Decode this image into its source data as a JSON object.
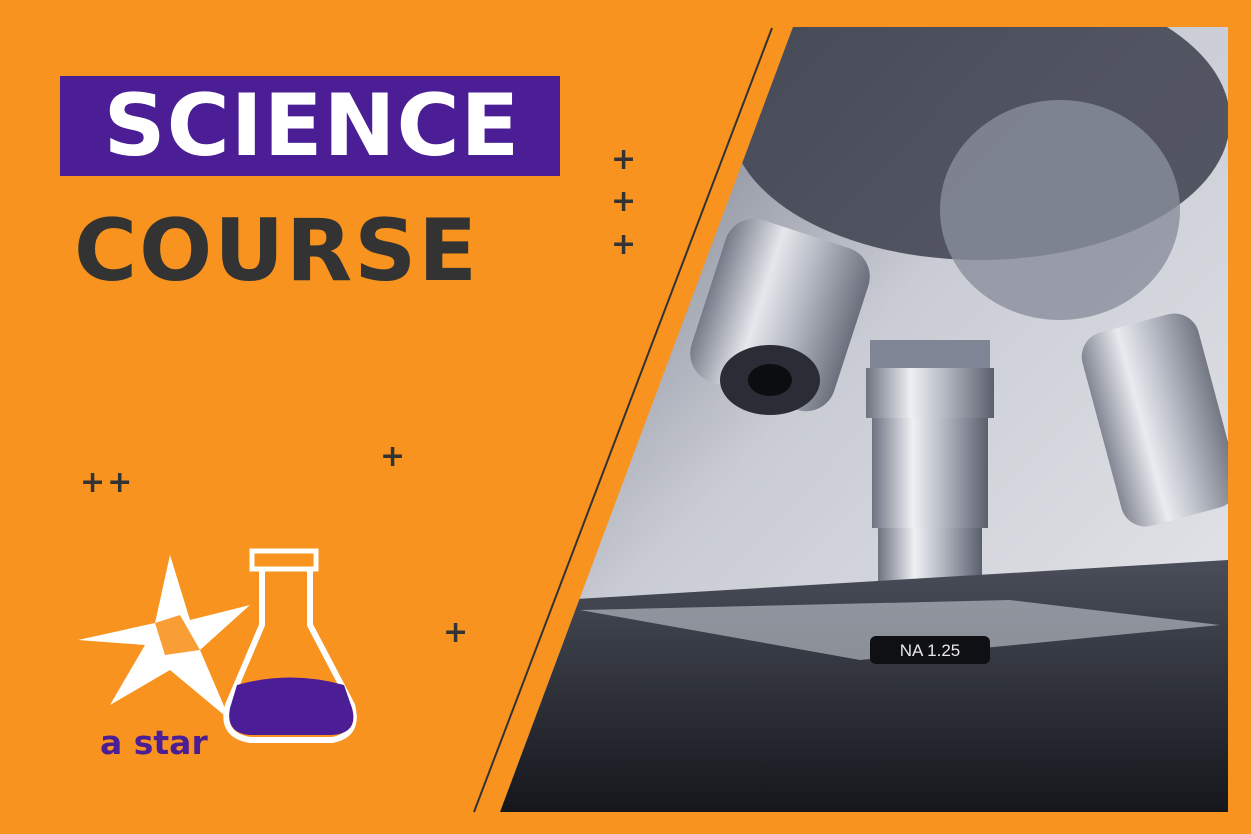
{
  "banner": {
    "title": "SCIENCE",
    "subtitle": "COURSE"
  },
  "decorations": {
    "plus_symbol": "+",
    "double_plus": "++"
  },
  "logo": {
    "brand_text": "a star",
    "icons": [
      "star-icon",
      "flask-icon"
    ]
  },
  "photo": {
    "subject": "microscope",
    "lens_label": "NA 1.25"
  },
  "colors": {
    "background": "#F7931E",
    "accent_purple": "#4B1E96",
    "text_dark": "#333333",
    "white": "#FFFFFF"
  }
}
